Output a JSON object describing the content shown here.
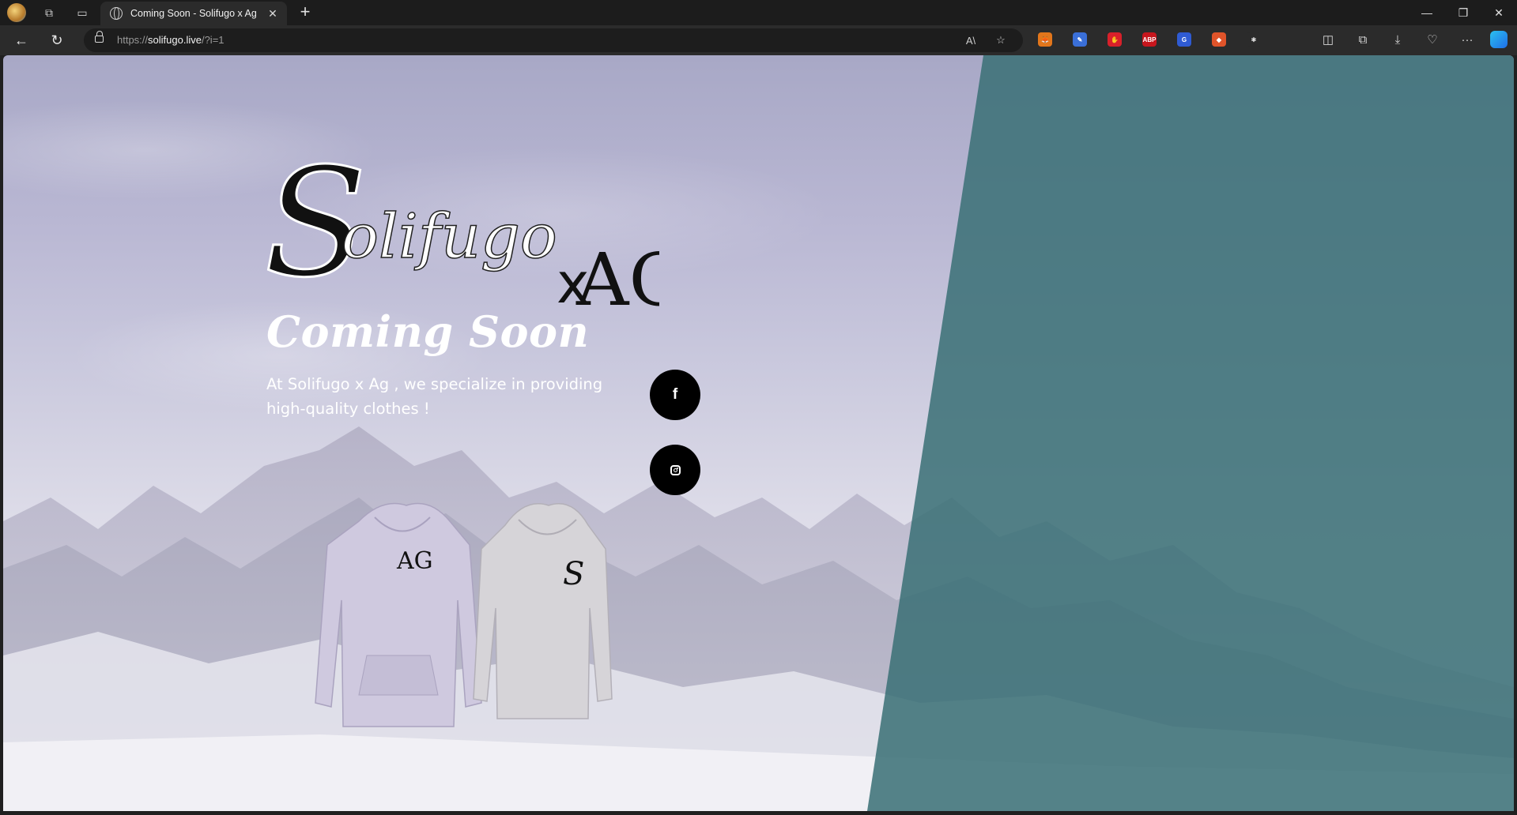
{
  "browser": {
    "tab": {
      "title": "Coming Soon - Solifugo x Ag",
      "close": "✕"
    },
    "new_tab": "+",
    "window_controls": {
      "minimize": "—",
      "restore": "❐",
      "close": "✕"
    },
    "address": {
      "scheme": "https://",
      "host": "solifugo.live",
      "path": "/?i=1"
    },
    "extensions": [
      {
        "name": "metamask-fox-icon",
        "color": "#e2761b",
        "glyph": "🦊"
      },
      {
        "name": "pen-extension-icon",
        "color": "#3a6fd8",
        "glyph": "✎"
      },
      {
        "name": "red-hand-icon",
        "color": "#d8202a",
        "glyph": "✋"
      },
      {
        "name": "adblock-plus-icon",
        "color": "#c7161d",
        "glyph": "ABP"
      },
      {
        "name": "grammar-g-icon",
        "color": "#2f5bd3",
        "glyph": "G"
      },
      {
        "name": "orange-gem-icon",
        "color": "#e0542a",
        "glyph": "◆"
      },
      {
        "name": "react-devtools-icon",
        "color": "#2b2b2b",
        "glyph": "⚛"
      }
    ]
  },
  "page": {
    "logo": {
      "main": "Solifugo",
      "connector": "x",
      "mark": "AG"
    },
    "headline": "Coming Soon",
    "tagline": "At Solifugo x Ag , we specialize in providing high-quality clothes !",
    "social": [
      {
        "name": "facebook-button",
        "glyph": "f"
      },
      {
        "name": "instagram-button",
        "glyph": ""
      }
    ],
    "products": [
      {
        "name": "lavender-hoodie",
        "logo": "AG"
      },
      {
        "name": "grey-hoodie",
        "logo": "S"
      }
    ]
  },
  "colors": {
    "overlay": "#3a7076",
    "headline": "#ffffff",
    "social_button": "#000000"
  }
}
